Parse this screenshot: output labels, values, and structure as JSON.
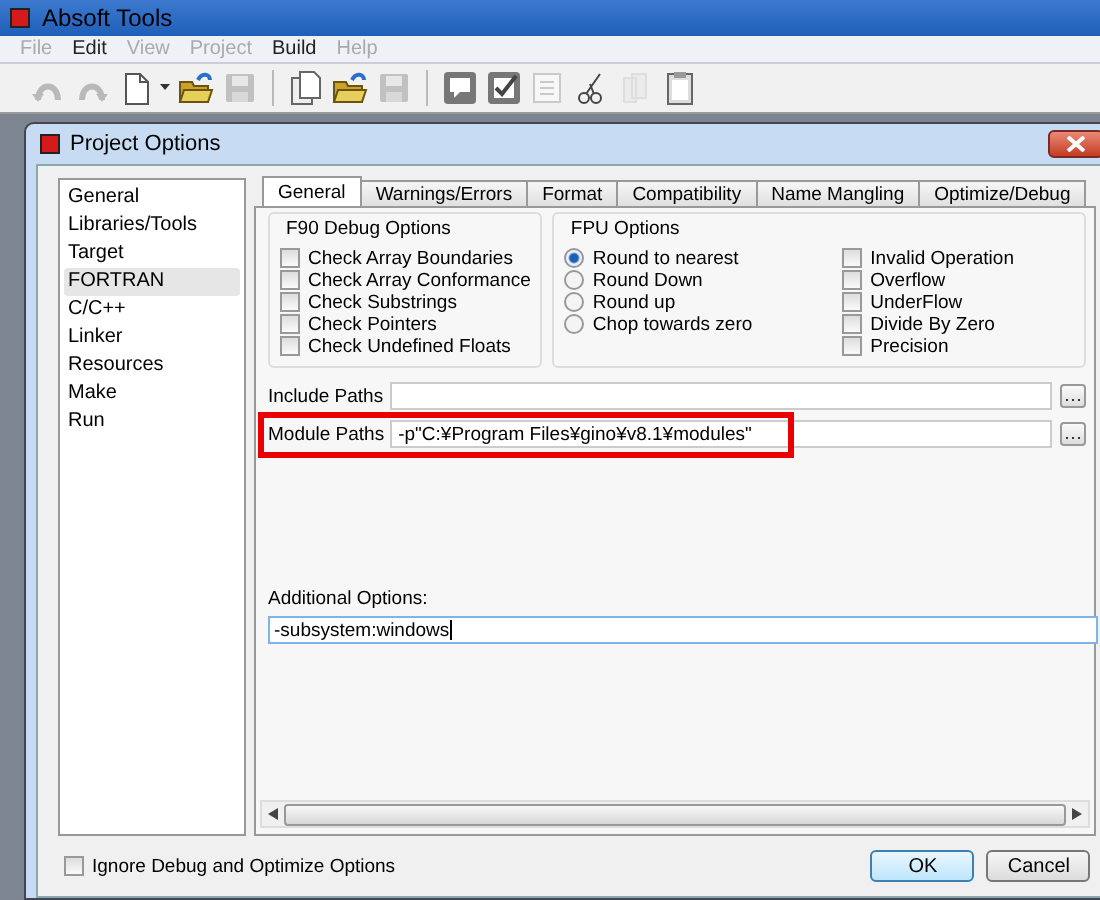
{
  "app": {
    "title": "Absoft Tools"
  },
  "menu": [
    {
      "label": "File",
      "disabled": true
    },
    {
      "label": "Edit",
      "disabled": false
    },
    {
      "label": "View",
      "disabled": true
    },
    {
      "label": "Project",
      "disabled": true
    },
    {
      "label": "Build",
      "disabled": false
    },
    {
      "label": "Help",
      "disabled": true
    }
  ],
  "toolbar": [
    {
      "kind": "undo",
      "disabled": true
    },
    {
      "kind": "redo",
      "disabled": true
    },
    {
      "kind": "new",
      "disabled": false
    },
    {
      "kind": "open",
      "disabled": false
    },
    {
      "kind": "save",
      "disabled": true
    },
    {
      "kind": "separator"
    },
    {
      "kind": "pages",
      "disabled": false
    },
    {
      "kind": "open",
      "disabled": false
    },
    {
      "kind": "save",
      "disabled": true
    },
    {
      "kind": "separator"
    },
    {
      "kind": "comment",
      "disabled": false
    },
    {
      "kind": "check",
      "disabled": false
    },
    {
      "kind": "list",
      "disabled": true
    },
    {
      "kind": "cut",
      "disabled": false
    },
    {
      "kind": "copy",
      "disabled": true
    },
    {
      "kind": "paste",
      "disabled": false
    }
  ],
  "dialog": {
    "title": "Project Options",
    "categories": [
      {
        "label": "General",
        "selected": false
      },
      {
        "label": "Libraries/Tools",
        "selected": false
      },
      {
        "label": "Target",
        "selected": false
      },
      {
        "label": "FORTRAN",
        "selected": true
      },
      {
        "label": "C/C++",
        "selected": false
      },
      {
        "label": "Linker",
        "selected": false
      },
      {
        "label": "Resources",
        "selected": false
      },
      {
        "label": "Make",
        "selected": false
      },
      {
        "label": "Run",
        "selected": false
      }
    ],
    "tabs": [
      {
        "label": "General",
        "selected": true
      },
      {
        "label": "Warnings/Errors",
        "selected": false
      },
      {
        "label": "Format",
        "selected": false
      },
      {
        "label": "Compatibility",
        "selected": false
      },
      {
        "label": "Name Mangling",
        "selected": false
      },
      {
        "label": "Optimize/Debug",
        "selected": false
      }
    ],
    "debug_options": {
      "title": "F90 Debug Options",
      "items": [
        {
          "label": "Check Array Boundaries",
          "checked": false
        },
        {
          "label": "Check Array Conformance",
          "checked": false
        },
        {
          "label": "Check Substrings",
          "checked": false
        },
        {
          "label": "Check Pointers",
          "checked": false
        },
        {
          "label": "Check Undefined Floats",
          "checked": false
        }
      ]
    },
    "fpu_options": {
      "title": "FPU Options",
      "rounding": [
        {
          "label": "Round to nearest",
          "selected": true
        },
        {
          "label": "Round Down",
          "selected": false
        },
        {
          "label": "Round up",
          "selected": false
        },
        {
          "label": "Chop towards zero",
          "selected": false
        }
      ],
      "exceptions": [
        {
          "label": "Invalid Operation",
          "checked": false
        },
        {
          "label": "Overflow",
          "checked": false
        },
        {
          "label": "UnderFlow",
          "checked": false
        },
        {
          "label": "Divide By Zero",
          "checked": false
        },
        {
          "label": "Precision",
          "checked": false
        }
      ]
    },
    "paths": [
      {
        "label": "Include Paths",
        "highlighted": false
      },
      {
        "label": "Module Paths",
        "value": "-p\"C:¥Program Files¥gino¥v8.1¥modules\"",
        "highlighted": true
      }
    ],
    "additional_options": {
      "label": "Additional Options:",
      "value": "-subsystem:windows"
    },
    "ignore_option": {
      "label": "Ignore Debug and Optimize Options",
      "checked": false
    },
    "buttons": [
      {
        "label": "OK",
        "default": true
      },
      {
        "label": "Cancel",
        "default": false
      }
    ]
  }
}
